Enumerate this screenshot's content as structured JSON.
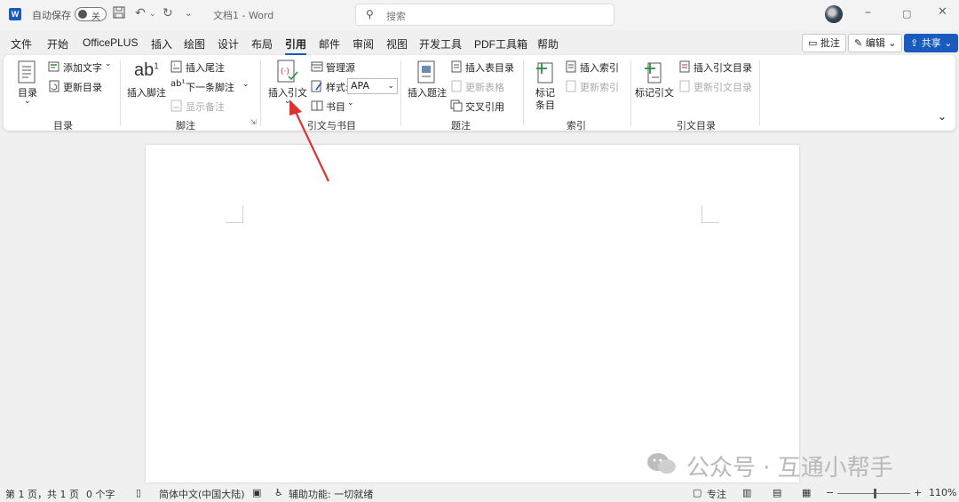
{
  "titlebar": {
    "autosave_label": "自动保存",
    "toggle_state": "关",
    "doc_title": "文档1 - Word",
    "search_placeholder": "搜索",
    "minimize": "–",
    "maximize": "▢",
    "close": "✕"
  },
  "tabs": [
    "文件",
    "开始",
    "OfficePLUS",
    "插入",
    "绘图",
    "设计",
    "布局",
    "引用",
    "邮件",
    "审阅",
    "视图",
    "开发工具",
    "PDF工具箱",
    "帮助"
  ],
  "active_tab": "引用",
  "right_buttons": {
    "comments": "批注",
    "editing": "编辑",
    "share": "共享"
  },
  "ribbon": {
    "toc": {
      "big_label": "目录",
      "add_text": "添加文字",
      "update_toc": "更新目录",
      "group": "目录"
    },
    "footnotes": {
      "big_label": "插入脚注",
      "insert_endnote": "插入尾注",
      "next_footnote": "下一条脚注",
      "show_notes": "显示备注",
      "group": "脚注"
    },
    "citations": {
      "insert_citation": "插入引文",
      "manage_sources": "管理源",
      "style_label": "样式:",
      "style_value": "APA",
      "bibliography": "书目",
      "group": "引文与书目"
    },
    "captions": {
      "big_label": "插入题注",
      "insert_table_of_figures": "插入表目录",
      "update_table": "更新表格",
      "cross_reference": "交叉引用",
      "group": "题注"
    },
    "index": {
      "mark_entry_line1": "标记",
      "mark_entry_line2": "条目",
      "insert_index": "插入索引",
      "update_index": "更新索引",
      "group": "索引"
    },
    "toa": {
      "mark_citation": "标记引文",
      "insert_toa": "插入引文目录",
      "update_toa": "更新引文目录",
      "group": "引文目录"
    }
  },
  "watermark": "公众号 · 互通小帮手",
  "statusbar": {
    "page_info": "第 1 页，共 1 页",
    "word_count": "0 个字",
    "language": "简体中文(中国大陆)",
    "accessibility": "辅助功能: 一切就绪",
    "focus": "专注",
    "zoom_minus": "−",
    "zoom_plus": "+",
    "zoom": "110%"
  },
  "colors": {
    "accent": "#185abd",
    "arrow": "#e03030"
  }
}
